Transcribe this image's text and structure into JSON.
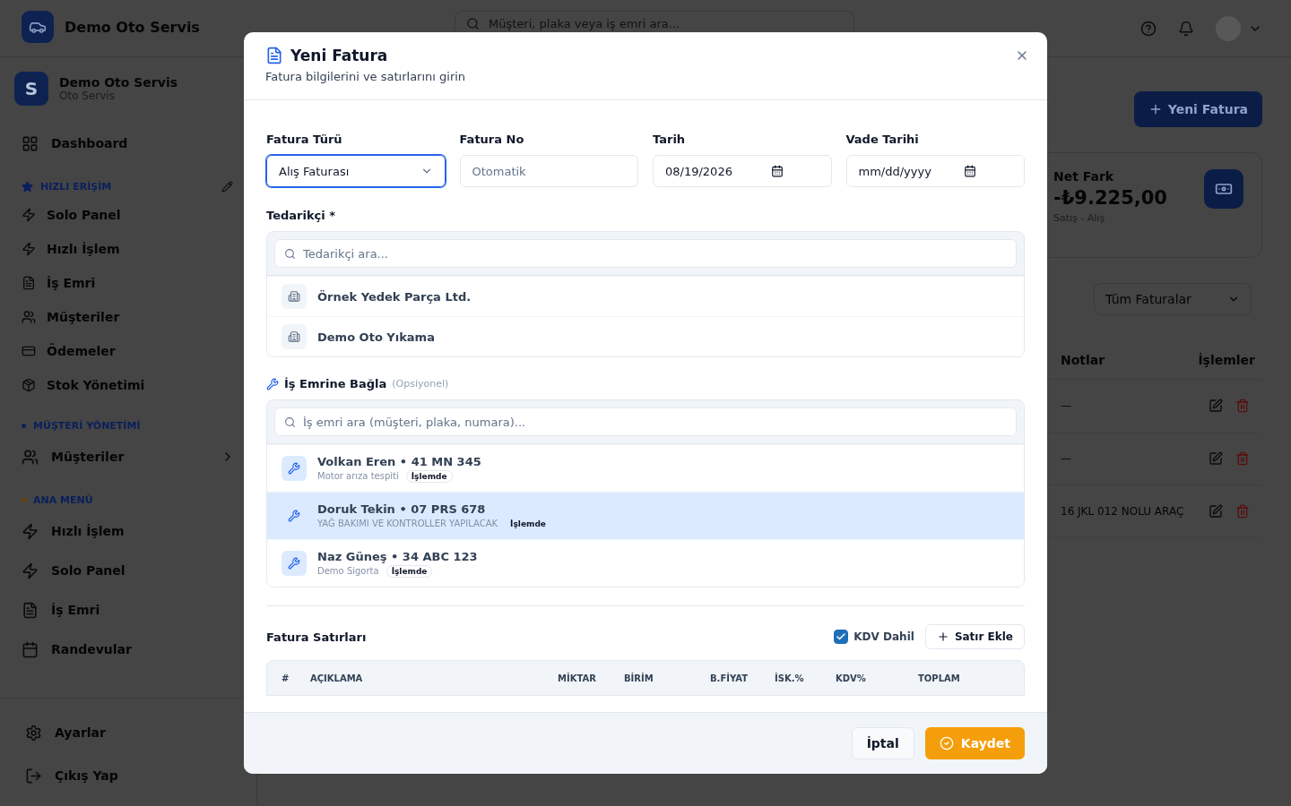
{
  "app": {
    "brand": "Demo Oto Servis",
    "search_placeholder": "Müşteri, plaka veya iş emri ara..."
  },
  "sidebar": {
    "workspace": {
      "initial": "S",
      "name": "Demo Oto Servis",
      "type": "Oto Servis"
    },
    "sections": [
      {
        "kind": "plain",
        "items": [
          {
            "label": "Dashboard",
            "kind": "dashboard"
          }
        ]
      },
      {
        "kind": "star",
        "title": "HIZLI ERİŞİM",
        "color": "#0a1f5c",
        "items": [
          {
            "label": "Solo Panel",
            "kind": "quick"
          },
          {
            "label": "Hızlı İşlem",
            "kind": "quick"
          },
          {
            "label": "İş Emri",
            "kind": "document"
          },
          {
            "label": "Müşteriler",
            "kind": "people"
          },
          {
            "label": "Ödemeler",
            "kind": "payment"
          },
          {
            "label": "Stok Yönetimi",
            "kind": "stock"
          }
        ]
      },
      {
        "kind": "dot",
        "title": "MÜŞTERİ YÖNETİMİ",
        "color": "#0a1f5c",
        "items": [
          {
            "label": "Müşteriler",
            "kind": "people-group"
          }
        ]
      },
      {
        "kind": "dot",
        "title": "ANA MENÜ",
        "color": "#6b4306",
        "items": [
          {
            "label": "Hızlı İşlem",
            "kind": "quick"
          },
          {
            "label": "Solo Panel",
            "kind": "quick"
          },
          {
            "label": "İş Emri",
            "kind": "document"
          },
          {
            "label": "Randevular",
            "kind": "schedule"
          }
        ]
      }
    ],
    "footer": [
      {
        "label": "Ayarlar",
        "kind": "settings"
      },
      {
        "label": "Çıkış Yap",
        "kind": "logout"
      }
    ]
  },
  "main": {
    "new_button": "Yeni Fatura",
    "stat": {
      "label": "Net Fark",
      "value": "-₺9.225,00",
      "sub": "Satış - Alış"
    },
    "filter": "Tüm Faturalar",
    "table": {
      "columns": [
        "Notlar",
        "İşlemler"
      ],
      "rows": [
        {
          "note": "—"
        },
        {
          "note": "—"
        },
        {
          "note": "16 JKL 012 NOLU ARAÇ"
        }
      ]
    }
  },
  "modal": {
    "title": "Yeni Fatura",
    "subtitle": "Fatura bilgilerini ve satırlarını girin",
    "fields": [
      {
        "label": "Fatura Türü",
        "kind": "select",
        "value": "Alış Faturası",
        "focused": true
      },
      {
        "label": "Fatura No",
        "kind": "text",
        "placeholder": "Otomatik",
        "focused": false
      },
      {
        "label": "Tarih",
        "kind": "date",
        "value": "08/19/2026",
        "focused": false
      },
      {
        "label": "Vade Tarihi",
        "kind": "date",
        "placeholder": "mm/dd/yyyy",
        "focused": false
      }
    ],
    "supplier": {
      "label": "Tedarikçi *",
      "search_placeholder": "Tedarikçi ara...",
      "items": [
        {
          "name": "Örnek Yedek Parça Ltd.",
          "selected": false
        },
        {
          "name": "Demo Oto Yıkama",
          "selected": false
        }
      ]
    },
    "work_order": {
      "label": "İş Emrine Bağla",
      "hint": "(Opsiyonel)",
      "search_placeholder": "İş emri ara (müşteri, plaka, numara)...",
      "items": [
        {
          "title": "Volkan Eren • 41 MN 345",
          "subtitle": "Motor arıza tespiti",
          "status": "İşlemde",
          "selected": false
        },
        {
          "title": "Doruk Tekin • 07 PRS 678",
          "subtitle": "YAĞ BAKIMI VE KONTROLLER YAPILACAK",
          "status": "İşlemde",
          "selected": true
        },
        {
          "title": "Naz Güneş • 34 ABC 123",
          "subtitle": "Demo Sigorta",
          "status": "İşlemde",
          "selected": false
        }
      ]
    },
    "lines": {
      "title": "Fatura Satırları",
      "vat_included": {
        "label": "KDV Dahil",
        "checked": true
      },
      "add_button": "Satır Ekle",
      "columns": [
        "#",
        "AÇIKLAMA",
        "MİKTAR",
        "BİRİM",
        "B.FİYAT",
        "İSK.%",
        "KDV%",
        "TOPLAM"
      ]
    },
    "cancel": "İptal",
    "save": "Kaydet"
  }
}
